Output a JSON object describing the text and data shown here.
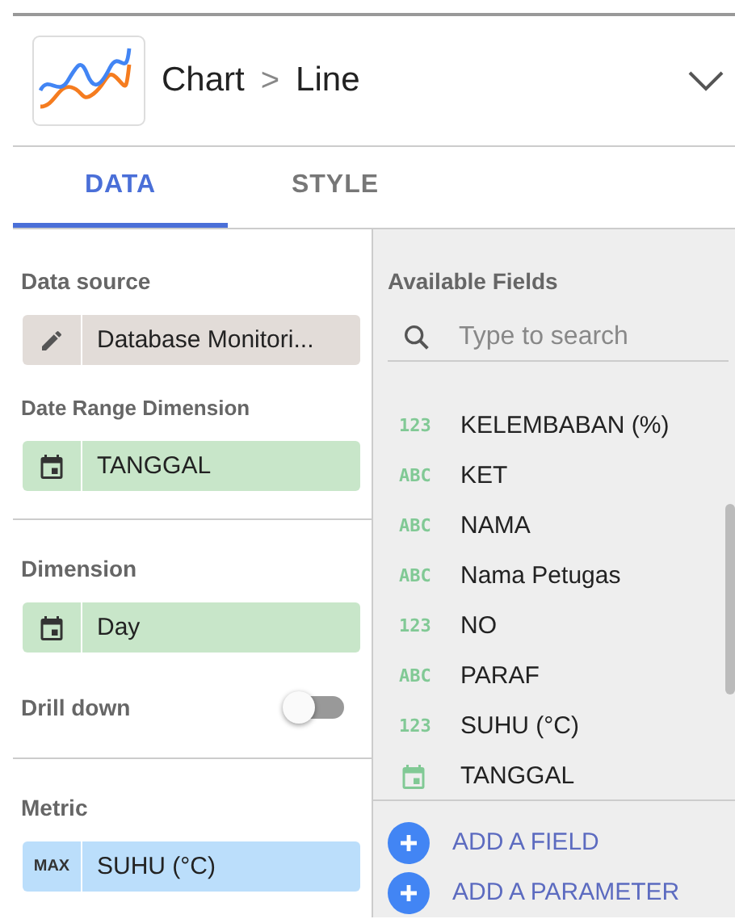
{
  "header": {
    "chart_type": "Chart",
    "separator": ">",
    "subtype": "Line"
  },
  "tabs": [
    {
      "label": "DATA",
      "selected": true
    },
    {
      "label": "STYLE",
      "selected": false
    }
  ],
  "data_source": {
    "label": "Data source",
    "value": "Database Monitori..."
  },
  "date_range": {
    "label": "Date Range Dimension",
    "value": "TANGGAL"
  },
  "dimension": {
    "label": "Dimension",
    "value": "Day"
  },
  "drill_down": {
    "label": "Drill down",
    "on": false
  },
  "metric": {
    "label": "Metric",
    "aggregation": "MAX",
    "value": "SUHU (°C)"
  },
  "available_fields": {
    "title": "Available Fields",
    "placeholder": "Type to search",
    "fields": [
      {
        "kind": "number",
        "type_label": "123",
        "name": "KELEMBABAN (%)"
      },
      {
        "kind": "text",
        "type_label": "ABC",
        "name": "KET"
      },
      {
        "kind": "text",
        "type_label": "ABC",
        "name": "NAMA"
      },
      {
        "kind": "text",
        "type_label": "ABC",
        "name": "Nama Petugas"
      },
      {
        "kind": "number",
        "type_label": "123",
        "name": "NO"
      },
      {
        "kind": "text",
        "type_label": "ABC",
        "name": "PARAF"
      },
      {
        "kind": "number",
        "type_label": "123",
        "name": "SUHU (°C)"
      },
      {
        "kind": "date",
        "name": "TANGGAL"
      }
    ],
    "actions": [
      {
        "label": "ADD A FIELD"
      },
      {
        "label": "ADD A PARAMETER"
      }
    ]
  }
}
